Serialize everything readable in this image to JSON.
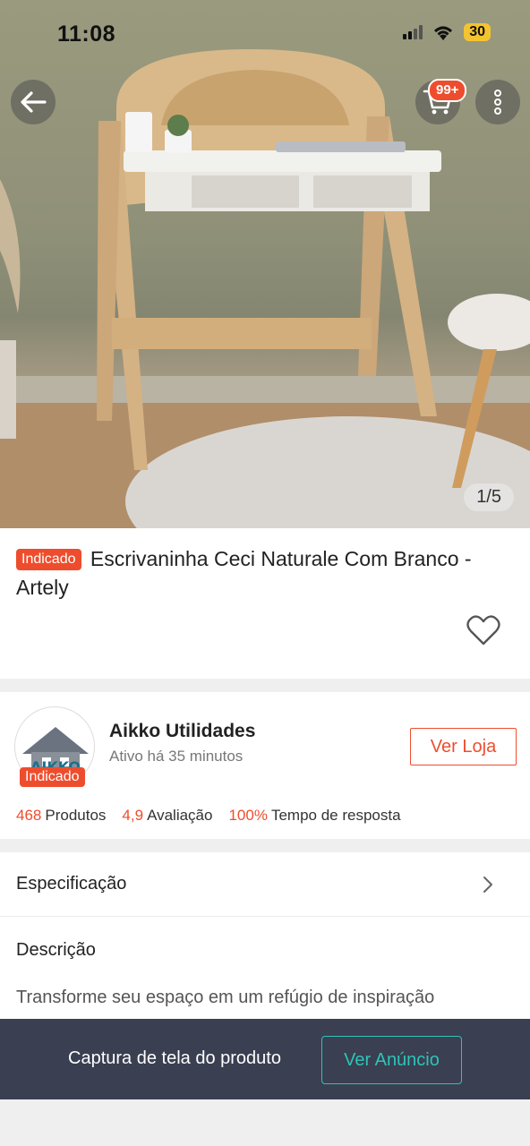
{
  "status_bar": {
    "time": "11:08",
    "battery": "30"
  },
  "hero": {
    "cart_badge": "99+",
    "pager": "1/5"
  },
  "product": {
    "tag": "Indicado",
    "title": "Escrivaninha Ceci Naturale Com Branco - Artely"
  },
  "shop": {
    "name": "Aikko Utilidades",
    "active": "Ativo há 35 minutos",
    "tag": "Indicado",
    "visit_label": "Ver Loja",
    "stats": [
      {
        "value": "468",
        "label": "Produtos"
      },
      {
        "value": "4,9",
        "label": "Avaliação"
      },
      {
        "value": "100%",
        "label": "Tempo de resposta"
      }
    ]
  },
  "sections": {
    "spec_label": "Especificação",
    "desc_title": "Descrição",
    "desc_text": "Transforme seu espaço em um refúgio de inspiração"
  },
  "bottom_bar": {
    "text": "Captura de tela do produto",
    "button": "Ver Anúncio"
  },
  "colors": {
    "accent": "#ee4d2d",
    "teal": "#2ec4b6",
    "bar": "#3a3f52"
  }
}
